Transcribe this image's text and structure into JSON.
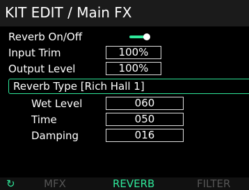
{
  "header": {
    "title": "KIT EDIT / Main FX"
  },
  "params": {
    "reverb_onoff": {
      "label": "Reverb On/Off",
      "state": "on"
    },
    "input_trim": {
      "label": "Input Trim",
      "value": "100%"
    },
    "output_level": {
      "label": "Output Level",
      "value": "100%"
    },
    "reverb_type": {
      "label": "Reverb Type [Rich Hall 1]"
    },
    "wet_level": {
      "label": "Wet Level",
      "value": "060"
    },
    "time": {
      "label": "Time",
      "value": "050"
    },
    "damping": {
      "label": "Damping",
      "value": "016"
    }
  },
  "tabs": {
    "icon": "refresh-icon",
    "items": [
      {
        "label": "MFX",
        "active": false
      },
      {
        "label": "REVERB",
        "active": true
      },
      {
        "label": "FILTER",
        "active": false
      }
    ]
  },
  "colors": {
    "accent": "#2fe89a",
    "inactive_tab": "#555555",
    "background": "#000000"
  }
}
